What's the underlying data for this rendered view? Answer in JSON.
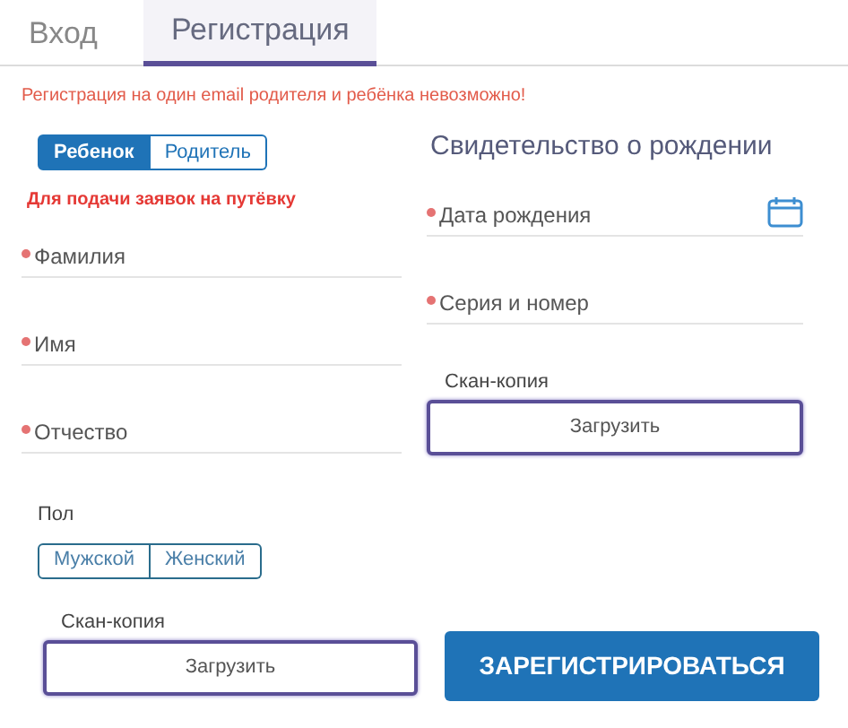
{
  "tabs": [
    {
      "label": "Вход",
      "selected": false
    },
    {
      "label": "Регистрация",
      "selected": true
    }
  ],
  "warning": "Регистрация на один email родителя и ребёнка невозможно!",
  "left": {
    "role_toggle": [
      {
        "label": "Ребенок",
        "selected": true
      },
      {
        "label": "Родитель",
        "selected": false
      }
    ],
    "notice": "Для подачи заявок на путёвку",
    "fields": [
      {
        "label": "Фамилия",
        "required": true
      },
      {
        "label": "Имя",
        "required": true
      },
      {
        "label": "Отчество",
        "required": true
      }
    ],
    "gender": {
      "label": "Пол",
      "options": [
        {
          "label": "Мужской",
          "selected": false
        },
        {
          "label": "Женский",
          "selected": false
        }
      ]
    },
    "scan": {
      "label": "Скан-копия",
      "button": "Загрузить"
    }
  },
  "right": {
    "heading": "Свидетельство о рождении",
    "fields": [
      {
        "label": "Дата рождения",
        "required": true,
        "kind": "date"
      },
      {
        "label": "Серия и номер",
        "required": true,
        "kind": "text"
      }
    ],
    "scan": {
      "label": "Скан-копия",
      "button": "Загрузить"
    }
  },
  "submit": "ЗАРЕГИСТРИРОВАТЬСЯ"
}
